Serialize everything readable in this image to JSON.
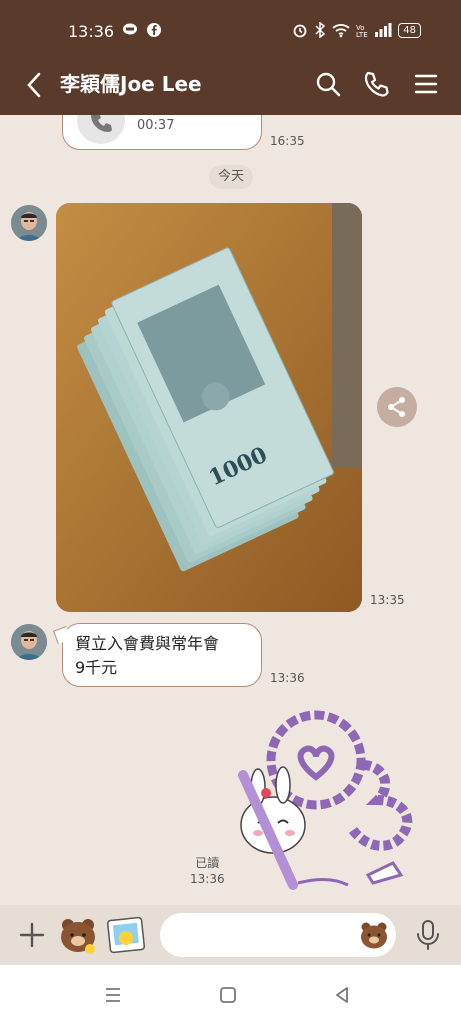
{
  "status_bar": {
    "time": "13:36",
    "battery": "48"
  },
  "header": {
    "title": "李穎儒Joe Lee"
  },
  "messages": {
    "call": {
      "duration": "00:37",
      "time": "16:35"
    },
    "day_separator": "今天",
    "photo_time": "13:35",
    "text": {
      "line1": "貿立入會費與常年會",
      "line2": "9千元",
      "time": "13:36"
    },
    "read_label": "已讀",
    "read_time": "13:36"
  },
  "input": {
    "placeholder": ""
  },
  "colors": {
    "header_bg": "#5a3a2a",
    "chat_bg": "#efe7df",
    "bubble_border": "#b48c7a"
  }
}
